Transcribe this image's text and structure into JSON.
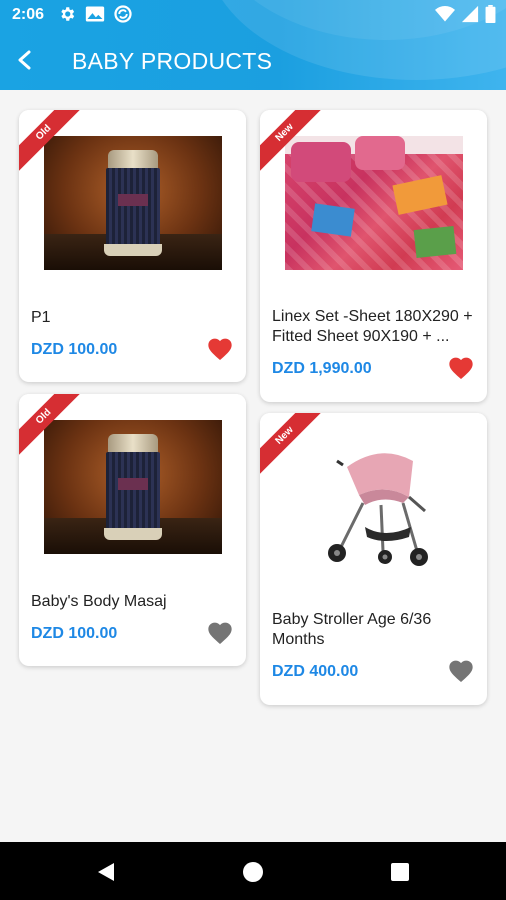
{
  "status_bar": {
    "time": "2:06"
  },
  "header": {
    "title": "BABY PRODUCTS"
  },
  "products": [
    {
      "name": "P1",
      "price": "DZD 100.00",
      "badge": "Old",
      "favorite": true
    },
    {
      "name": "Linex Set -Sheet 180X290 + Fitted Sheet 90X190 + ...",
      "price": "DZD 1,990.00",
      "badge": "New",
      "favorite": true
    },
    {
      "name": "Baby's Body Masaj",
      "price": "DZD 100.00",
      "badge": "Old",
      "favorite": false
    },
    {
      "name": "Baby Stroller Age 6/36 Months",
      "price": "DZD 400.00",
      "badge": "New",
      "favorite": false
    }
  ],
  "colors": {
    "accent": "#1e88e5",
    "header": "#1aa3e3",
    "favorite_on": "#e53935",
    "favorite_off": "#757575",
    "ribbon": "#d62e33"
  },
  "icons": {
    "back": "arrow-left-icon",
    "favorite": "heart-icon"
  }
}
